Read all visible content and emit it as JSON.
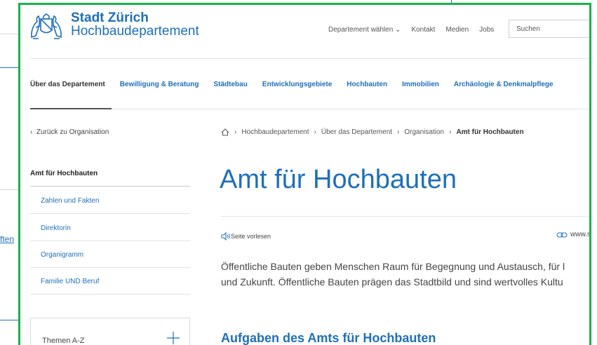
{
  "background": {
    "partial_link": "ften"
  },
  "header": {
    "brand_name": "Stadt Zürich",
    "department": "Hochbaudepartement",
    "topnav": [
      "Departement wählen ⌄",
      "Kontakt",
      "Medien",
      "Jobs"
    ],
    "search_placeholder": "Suchen"
  },
  "mainnav": {
    "items": [
      "Über das Departement",
      "Bewilligung & Beratung",
      "Städtebau",
      "Entwicklungsgebiete",
      "Hochbauten",
      "Immobilien",
      "Archäologie & Denkmalpflege"
    ],
    "active_index": 0
  },
  "sidebar": {
    "back_link": "Zurück zu Organisation",
    "title": "Amt für Hochbauten",
    "items": [
      "Zahlen und Fakten",
      "Direktorin",
      "Organigramm",
      "Familie UND Beruf"
    ],
    "themen_label": "Themen A-Z"
  },
  "breadcrumb": {
    "items": [
      "Hochbaudepartement",
      "Über das Departement",
      "Organisation"
    ],
    "current": "Amt für Hochbauten"
  },
  "content": {
    "title": "Amt für Hochbauten",
    "read_aloud": "Seite vorlesen",
    "share_text": "www.s",
    "intro_line1": "Öffentliche Bauten geben Menschen Raum für Begegnung und Austausch, für l",
    "intro_line2": "und Zukunft. Öffentliche Bauten prägen das Stadtbild und sind wertvolles Kultu",
    "section_heading": "Aufgaben des Amts für Hochbauten"
  },
  "colors": {
    "brand_blue": "#1f6fb8",
    "frame_green": "#19b34a"
  }
}
